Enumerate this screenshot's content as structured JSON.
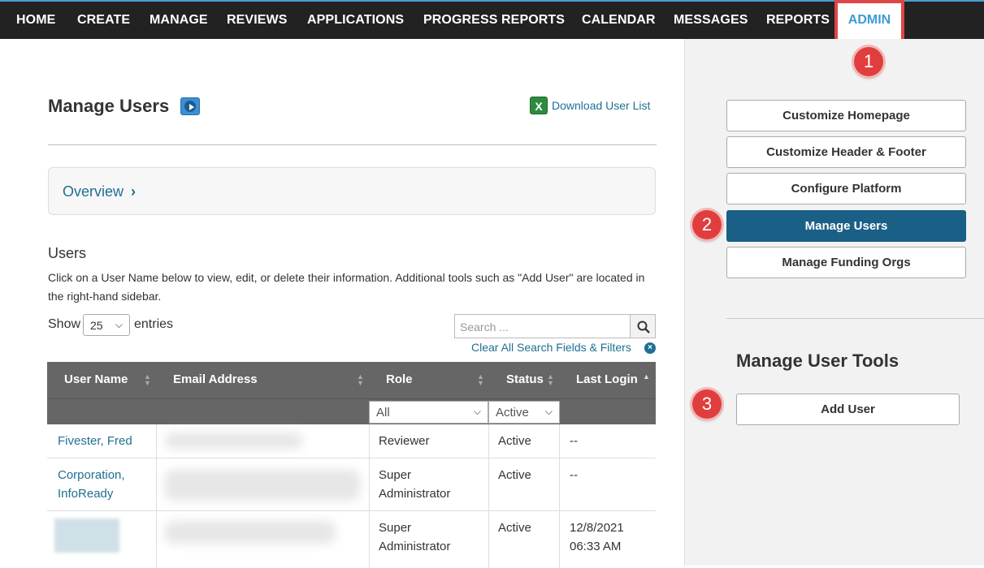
{
  "nav": {
    "home": "HOME",
    "create": "CREATE",
    "manage": "MANAGE",
    "reviews": "REVIEWS",
    "applications": "APPLICATIONS",
    "progress_reports": "PROGRESS REPORTS",
    "calendar": "CALENDAR",
    "messages": "MESSAGES",
    "reports": "REPORTS",
    "admin": "ADMIN"
  },
  "callouts": [
    "1",
    "2",
    "3"
  ],
  "main": {
    "title": "Manage Users",
    "video_icon": "play-video-icon",
    "download_icon": "excel-icon",
    "download_icon_glyph": "X",
    "download_label": "Download User List",
    "overview_label": "Overview",
    "overview_chevron": "›",
    "users_heading": "Users",
    "users_description": "Click on a User Name below to view, edit, or delete their information. Additional tools such as \"Add User\" are located in the right-hand sidebar.",
    "show_label": "Show",
    "show_value": "25",
    "entries_label": "entries",
    "search_placeholder": "Search ...",
    "clear_label": "Clear All Search Fields & Filters"
  },
  "table": {
    "columns": [
      "User Name",
      "Email Address",
      "Role",
      "Status",
      "Last Login"
    ],
    "filters": {
      "role": "All",
      "status": "Active"
    },
    "rows": [
      {
        "name": "Fivester, Fred",
        "role": "Reviewer",
        "status": "Active",
        "last_login": "--"
      },
      {
        "name_line1": "Corporation,",
        "name_line2": "InfoReady",
        "role_line1": "Super",
        "role_line2": "Administrator",
        "status": "Active",
        "last_login": "--"
      },
      {
        "role_line1": "Super",
        "role_line2": "Administrator",
        "status": "Active",
        "last_login_line1": "12/8/2021",
        "last_login_line2": "06:33 AM"
      }
    ]
  },
  "sidebar": {
    "buttons": [
      "Customize Homepage",
      "Customize Header & Footer",
      "Configure Platform",
      "Manage Users",
      "Manage Funding Orgs"
    ],
    "active_button": "Manage Users",
    "tools_heading": "Manage User Tools",
    "add_user": "Add User"
  },
  "colors": {
    "nav_bg": "#222222",
    "admin_accent": "#3b9bd3",
    "callout_red": "#e03e3e",
    "link": "#1e6f93",
    "active_button": "#1a5f86",
    "table_header": "#666666"
  }
}
